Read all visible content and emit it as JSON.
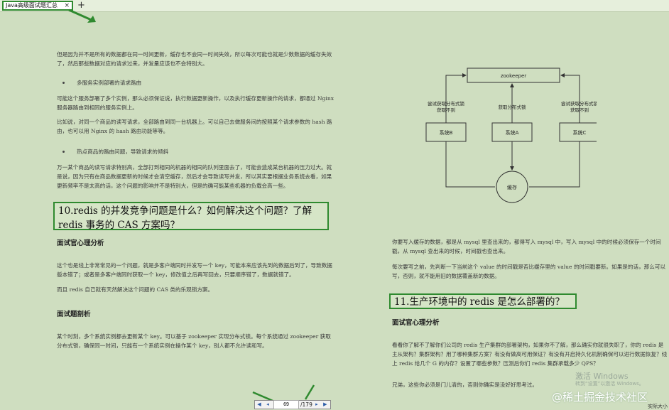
{
  "tab": {
    "title": "Java高级面试题汇总",
    "close": "×",
    "add": "+"
  },
  "left": {
    "p1": "但是因为并不是所有的数据都在同一时间更新，缓存也不会同一时间失效，所以每次可能也就是少数数据的缓存失效了，然后那些数据对应的请求过来，并发量应该也不会特别大。",
    "b1": "多服务实例部署的请求路由",
    "p2": "可能这个服务部署了多个实例，那么必须保证说，执行数据更新操作，以及执行缓存更新操作的请求，都通过 Nginx 服务器路由到相同的服务实例上。",
    "p3": "比如说，对同一个商品的读写请求，全部路由到同一台机器上。可以自己去做服务间的按照某个请求参数的 hash 路由，也可以用 Nginx 的 hash 路由功能等等。",
    "b2": "热点商品的路由问题，导致请求的倾斜",
    "p4": "万一某个商品的读写请求特别高，全部打到相同的机器的相同的队列里面去了，可能会造成某台机器的压力过大。就是说，因为只有在商品数据更新的时候才会清空缓存，然后才会导致读写并发，所以其实要根据业务系统去看，如果更新频率不是太高的话，这个问题的影响并不是特别大，但是的确可能某些机器的负载会高一些。",
    "q10": "10.redis 的并发竞争问题是什么？如何解决这个问题？了解 redis 事务的 CAS 方案吗？",
    "h_analysis": "面试官心理分析",
    "p5": "这个也是线上非常常见的一个问题，就是多客户端同时并发写一个 key，可能本来应该先到的数据后到了，导致数据版本错了；或者是多客户端同时获取一个 key，修改值之后再写回去，只要顺序错了，数据就错了。",
    "p6": "而且 redis 自己就有天然解决这个问题的 CAS 类的乐观锁方案。",
    "h_breakdown": "面试题剖析",
    "p7": "某个时刻，多个系统实例都去更新某个 key。可以基于 zookeeper 实现分布式锁。每个系统通过 zookeeper 获取分布式锁，确保同一时间，只能有一个系统实例在操作某个 key，别人都不允许读和写。"
  },
  "diagram": {
    "zookeeper": "zookeeper",
    "try_left": [
      "尝试获取分布式锁",
      "获取不到"
    ],
    "get_lock": "获取分布式锁",
    "try_right": [
      "尝试获取分布式锁",
      "获取不到"
    ],
    "sysB": "系统B",
    "sysA": "系统A",
    "sysC": "系统C",
    "cache": "缓存"
  },
  "right": {
    "p1": "你要写入缓存的数据，都是从 mysql 里查出来的，都得写入 mysql 中，写入 mysql 中的时候必须保存一个时间戳，从 mysql 查出来的时候，时间戳也查出来。",
    "p2": "每次要写之前，先判断一下当前这个 value 的时间戳是否比缓存里的 value 的时间戳要新。如果是的话，那么可以写，否则，就不能用旧的数据覆盖新的数据。",
    "q11": "11.生产环境中的 redis 是怎么部署的？",
    "h_analysis": "面试官心理分析",
    "p3": "看看你了解不了解你们公司的 redis 生产集群的部署架构，如果你不了解，那么确实你就很失职了，你的 redis 是主从架构？集群架构？用了哪种集群方案？有没有做高可用保证？有没有开启持久化机制确保可以进行数据恢复？线上 redis 给几个 G 的内存？设置了哪些参数？压测后你们 redis 集群承载多少 QPS？",
    "p4": "兄弟，这些你必须是门儿清的，否则你确实是没好好思考过。"
  },
  "nav": {
    "current_page": "69",
    "total": "/179"
  },
  "overlay": {
    "activate1": "激活 Windows",
    "activate2": "转到“设置”以激活 Windows。",
    "juejin": "@稀土掘金技术社区",
    "status": "实际大小"
  }
}
